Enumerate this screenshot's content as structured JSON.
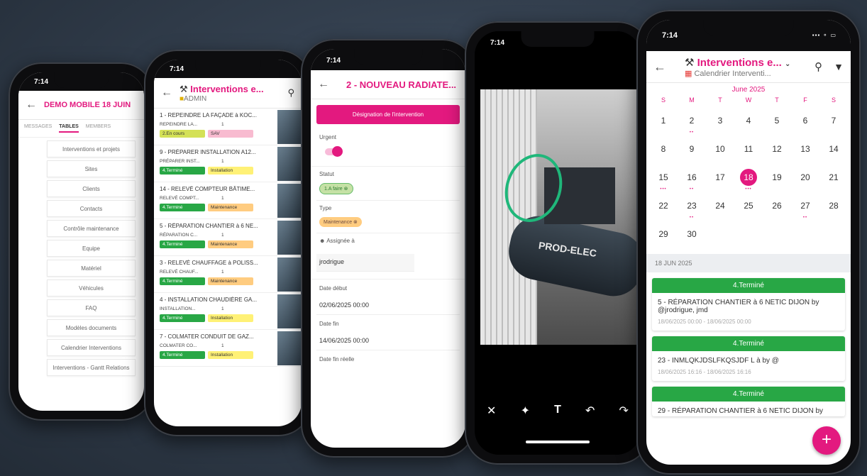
{
  "status_time": "7:14",
  "phone1": {
    "title": "DEMO MOBILE 18 JUIN",
    "tabs": [
      "MESSAGES",
      "TABLES",
      "MEMBERS"
    ],
    "tables": [
      "Interventions et projets",
      "Sites",
      "Clients",
      "Contacts",
      "Contrôle maintenance",
      "Equipe",
      "Matériel",
      "Véhicules",
      "FAQ",
      "Modèles documents",
      "Calendrier Interventions",
      "Interventions - Gantt Relations"
    ]
  },
  "phone2": {
    "title": "Interventions e...",
    "subtitle": "ADMIN",
    "items": [
      {
        "title": "1 - REPEINDRE LA FAÇADE à KOC...",
        "short": "REPEINDRE LA...",
        "qty": "1",
        "status": "2.En cours",
        "type": "SAV"
      },
      {
        "title": "9 - PRÉPARER INSTALLATION A12...",
        "short": "PRÉPARER INST...",
        "qty": "1",
        "status": "4.Terminé",
        "type": "Installation"
      },
      {
        "title": "14 - RELEVÉ COMPTEUR BÂTIME...",
        "short": "RELEVÉ COMPT...",
        "qty": "1",
        "status": "4.Terminé",
        "type": "Maintenance"
      },
      {
        "title": "5 - RÉPARATION CHANTIER à 6 NE...",
        "short": "RÉPARATION C...",
        "qty": "1",
        "status": "4.Terminé",
        "type": "Maintenance"
      },
      {
        "title": "3 - RELEVÉ CHAUFFAGE à POLISS...",
        "short": "RELEVÉ CHAUF...",
        "qty": "1",
        "status": "4.Terminé",
        "type": "Maintenance"
      },
      {
        "title": "4 - INSTALLATION CHAUDIÈRE GA...",
        "short": "INSTALLATION...",
        "qty": "1",
        "status": "4.Terminé",
        "type": "Installation"
      },
      {
        "title": "7 - COLMATER CONDUIT DE GAZ...",
        "short": "COLMATER CO...",
        "qty": "1",
        "status": "4.Terminé",
        "type": "Installation"
      }
    ]
  },
  "phone3": {
    "title": "2 - NOUVEAU RADIATE...",
    "section_button": "Désignation de l'intervention",
    "urgent_label": "Urgent",
    "statut_label": "Statut",
    "statut_value": "1.A faire",
    "type_label": "Type",
    "type_value": "Maintenance",
    "assignee_label": "Assignée à",
    "assignee_value": "jrodrigue",
    "start_label": "Date début",
    "start_value": "02/06/2025 00:00",
    "end_label": "Date fin",
    "end_value": "14/06/2025 00:00",
    "real_end_label": "Date fin réelle"
  },
  "phone4": {
    "image_text": "PROD-ELEC"
  },
  "phone5": {
    "title": "Interventions e...",
    "subtitle": "Calendrier Interventi...",
    "month": "June 2025",
    "weekdays": [
      "S",
      "M",
      "T",
      "W",
      "T",
      "F",
      "S"
    ],
    "days": [
      "1",
      "2",
      "3",
      "4",
      "5",
      "6",
      "7",
      "8",
      "9",
      "10",
      "11",
      "12",
      "13",
      "14",
      "15",
      "16",
      "17",
      "18",
      "19",
      "20",
      "21",
      "22",
      "23",
      "24",
      "25",
      "26",
      "27",
      "28",
      "29",
      "30"
    ],
    "selected_day": "18",
    "date_header": "18 JUN 2025",
    "events": [
      {
        "status": "4.Terminé",
        "title": "5 - RÉPARATION CHANTIER à 6 NETIC DIJON by @jrodrigue, jmd",
        "dates": "18/06/2025 00:00 - 18/06/2025 00:00"
      },
      {
        "status": "4.Terminé",
        "title": "23 - INMLQKJDSLFKQSJDF L à by @",
        "dates": "18/06/2025 16:16 - 18/06/2025 16:16"
      },
      {
        "status": "4.Terminé",
        "title": "29 - RÉPARATION CHANTIER à 6 NETIC DIJON by",
        "dates": ""
      }
    ],
    "fab": "+"
  },
  "colors": {
    "accent": "#e3197f",
    "done": "#28a745",
    "in_progress": "#d4e157",
    "sav": "#f8bbd0",
    "installation": "#fff176",
    "maintenance": "#ffcc80"
  }
}
